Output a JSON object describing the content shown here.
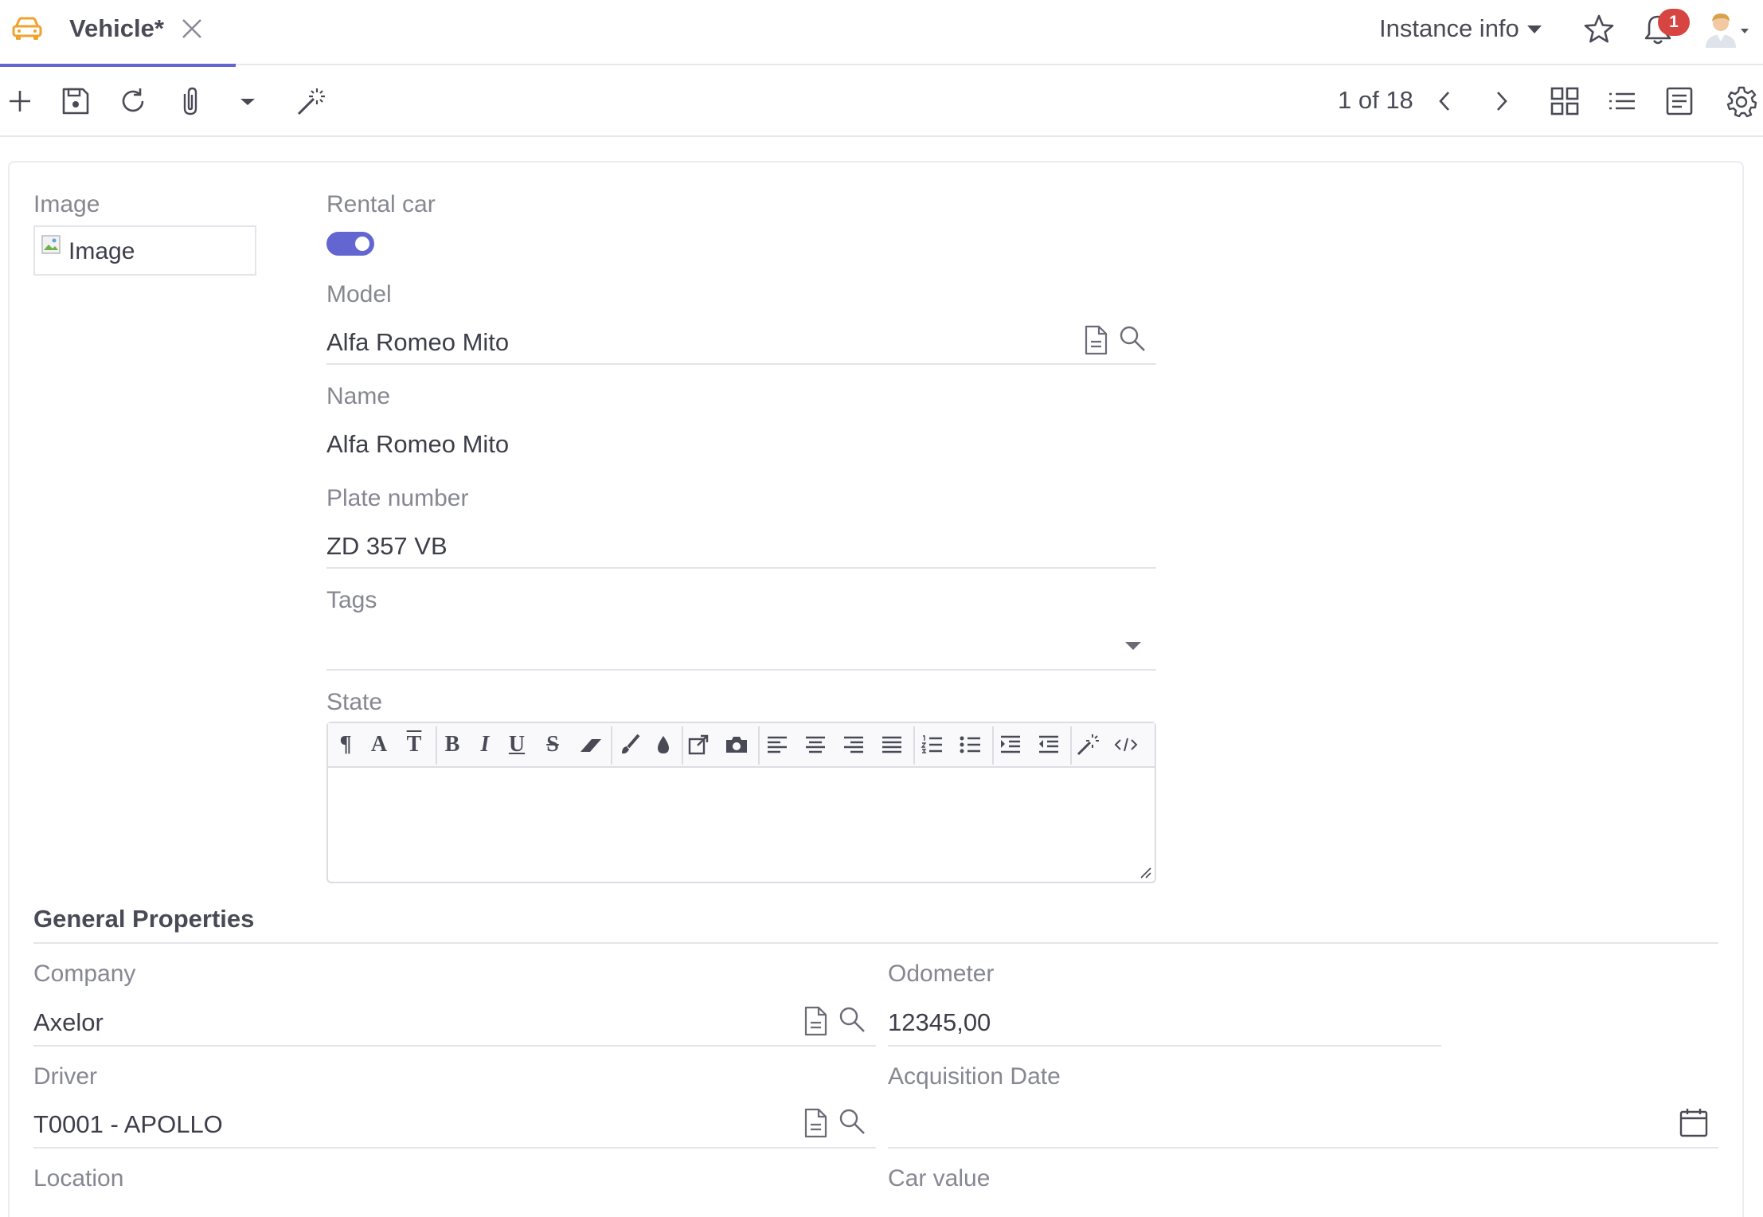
{
  "tab": {
    "title": "Vehicle*"
  },
  "header": {
    "instance_info": "Instance info",
    "notifications_count": "1"
  },
  "toolbar": {
    "pager": "1 of 18"
  },
  "form": {
    "image": {
      "label": "Image",
      "alt": "Image"
    },
    "rental_car": {
      "label": "Rental car",
      "checked": true
    },
    "model": {
      "label": "Model",
      "value": "Alfa Romeo Mito"
    },
    "name": {
      "label": "Name",
      "value": "Alfa Romeo Mito"
    },
    "plate_number": {
      "label": "Plate number",
      "value": "ZD 357 VB"
    },
    "tags": {
      "label": "Tags",
      "value": ""
    },
    "state": {
      "label": "State",
      "toolbar_icons": [
        "paragraph-icon",
        "font-icon",
        "text-height-icon",
        "bold-icon",
        "italic-icon",
        "underline-icon",
        "strikethrough-icon",
        "eraser-icon",
        "brush-icon",
        "color-drop-icon",
        "link-icon",
        "camera-icon",
        "align-left-icon",
        "align-center-icon",
        "align-right-icon",
        "align-justify-icon",
        "ordered-list-icon",
        "unordered-list-icon",
        "indent-icon",
        "outdent-icon",
        "magic-wand-icon",
        "code-icon"
      ]
    }
  },
  "general": {
    "title": "General Properties",
    "company": {
      "label": "Company",
      "value": "Axelor"
    },
    "odometer": {
      "label": "Odometer",
      "value": "12345,00"
    },
    "driver": {
      "label": "Driver",
      "value": "T0001 - APOLLO"
    },
    "acquisition_date": {
      "label": "Acquisition Date",
      "value": ""
    },
    "location": {
      "label": "Location"
    },
    "car_value": {
      "label": "Car value"
    }
  },
  "colors": {
    "accent": "#6366d1",
    "badge": "#d64541",
    "car_icon": "#f0a22e"
  }
}
